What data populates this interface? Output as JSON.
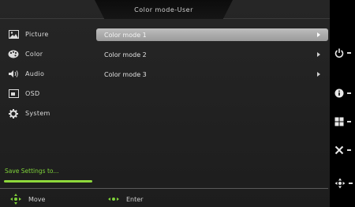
{
  "window": {
    "title": "Color mode-User"
  },
  "sidebar": {
    "items": [
      {
        "label": "Picture",
        "icon": "picture-icon"
      },
      {
        "label": "Color",
        "icon": "palette-icon"
      },
      {
        "label": "Audio",
        "icon": "speaker-icon"
      },
      {
        "label": "OSD",
        "icon": "osd-icon"
      },
      {
        "label": "System",
        "icon": "gear-icon"
      }
    ]
  },
  "main": {
    "rows": [
      {
        "label": "Color mode 1",
        "selected": true
      },
      {
        "label": "Color mode 2",
        "selected": false
      },
      {
        "label": "Color mode 3",
        "selected": false
      }
    ]
  },
  "save": {
    "label": "Save Settings to...",
    "progress": 1.0
  },
  "footer": {
    "move_label": "Move",
    "enter_label": "Enter"
  },
  "hardware_keys": [
    "power-icon",
    "info-icon",
    "menu-icon",
    "close-icon",
    "navigation-icon"
  ],
  "colors": {
    "accent_green": "#7fd33a",
    "selected_row": "#aaaaaa"
  }
}
